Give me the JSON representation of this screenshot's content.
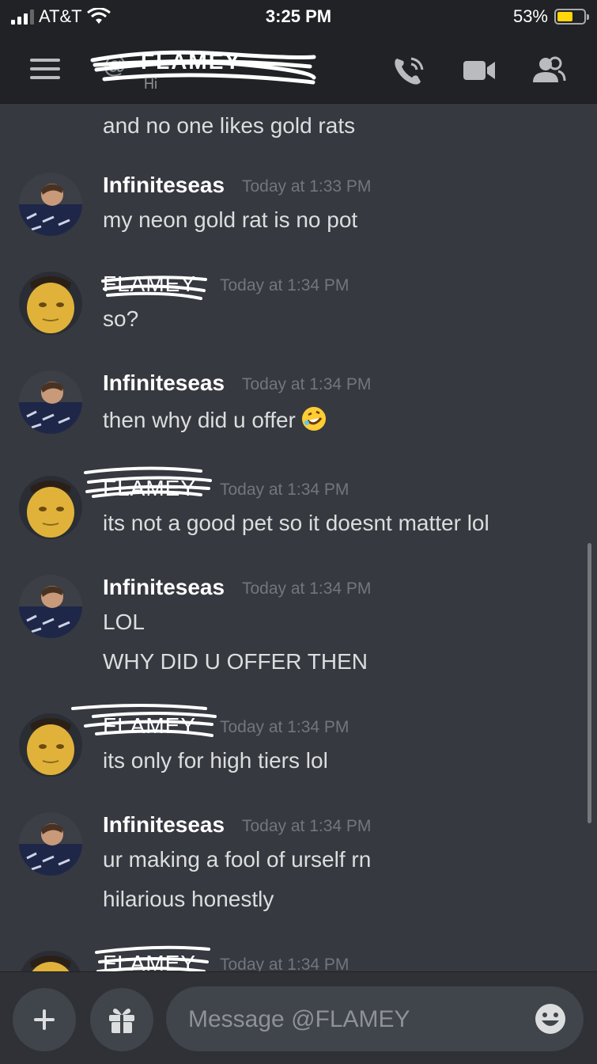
{
  "status_bar": {
    "carrier": "AT&T",
    "time": "3:25 PM",
    "battery_percent": "53%",
    "battery_level": 0.53
  },
  "header": {
    "at_symbol": "@",
    "channel_name": "FLAMEY",
    "subtitle": "Hi",
    "icons": [
      "menu-icon",
      "call-icon",
      "video-icon",
      "members-icon"
    ]
  },
  "messages": {
    "continuation": "and no one likes gold rats",
    "items": [
      {
        "author": "Infiniteseas",
        "timestamp": "Today at 1:33 PM",
        "lines": [
          "my neon gold rat is no pot"
        ]
      },
      {
        "author": "FLAMEY",
        "timestamp": "Today at 1:34 PM",
        "lines": [
          "so?"
        ]
      },
      {
        "author": "Infiniteseas",
        "timestamp": "Today at 1:34 PM",
        "lines": [
          "then why did u offer"
        ]
      },
      {
        "author": "FLAMEY",
        "timestamp": "Today at 1:34 PM",
        "lines": [
          "its not a good pet so it doesnt matter lol"
        ]
      },
      {
        "author": "Infiniteseas",
        "timestamp": "Today at 1:34 PM",
        "lines": [
          "LOL",
          "WHY DID U OFFER THEN"
        ]
      },
      {
        "author": "FLAMEY",
        "timestamp": "Today at 1:34 PM",
        "lines": [
          "its only for high tiers lol"
        ]
      },
      {
        "author": "Infiniteseas",
        "timestamp": "Today at 1:34 PM",
        "lines": [
          "ur making a fool of urself rn",
          "hilarious honestly"
        ]
      },
      {
        "author": "FLAMEY",
        "timestamp": "Today at 1:34 PM",
        "lines": []
      }
    ]
  },
  "composer": {
    "placeholder": "Message @FLAMEY",
    "icons": [
      "plus-icon",
      "gift-icon",
      "emoji-icon"
    ]
  },
  "colors": {
    "background": "#36393f",
    "header": "#202225",
    "text": "#dcddde",
    "muted": "#72767d",
    "battery": "#ffd60a"
  }
}
